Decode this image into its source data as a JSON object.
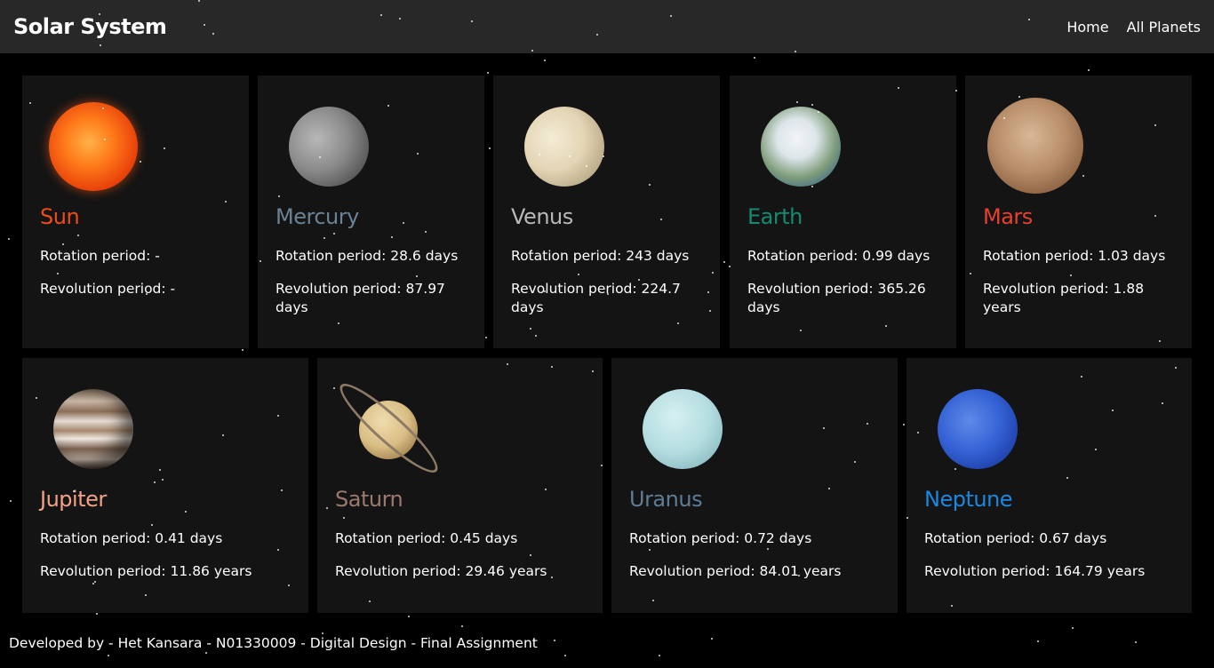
{
  "header": {
    "title": "Solar System",
    "nav": [
      "Home",
      "All Planets"
    ]
  },
  "rotation_label": "Rotation period:",
  "revolution_label": "Revolution period:",
  "planets": [
    {
      "name": "Sun",
      "rotation": "Rotation period: -",
      "revolution": "Revolution period: -",
      "color": "#f04a1a"
    },
    {
      "name": "Mercury",
      "rotation": "Rotation period: 28.6 days",
      "revolution": "Revolution period: 87.97 days",
      "color": "#6a8296"
    },
    {
      "name": "Venus",
      "rotation": "Rotation period: 243 days",
      "revolution": "Revolution period: 224.7 days",
      "color": "#b9b9b9"
    },
    {
      "name": "Earth",
      "rotation": "Rotation period: 0.99 days",
      "revolution": "Revolution period: 365.26 days",
      "color": "#138a72"
    },
    {
      "name": "Mars",
      "rotation": "Rotation period: 1.03 days",
      "revolution": "Revolution period: 1.88 years",
      "color": "#e74030"
    },
    {
      "name": "Jupiter",
      "rotation": "Rotation period: 0.41 days",
      "revolution": "Revolution period: 11.86 years",
      "color": "#f2a187"
    },
    {
      "name": "Saturn",
      "rotation": "Rotation period: 0.45 days",
      "revolution": "Revolution period: 29.46 years",
      "color": "#9a7a6e"
    },
    {
      "name": "Uranus",
      "rotation": "Rotation period: 0.72 days",
      "revolution": "Revolution period: 84.01 years",
      "color": "#5f7c95"
    },
    {
      "name": "Neptune",
      "rotation": "Rotation period: 0.67 days",
      "revolution": "Revolution period: 164.79 years",
      "color": "#1a88e0"
    }
  ],
  "footer": {
    "text": "Developed by - Het Kansara - N01330009 - Digital Design - Final Assignment"
  }
}
